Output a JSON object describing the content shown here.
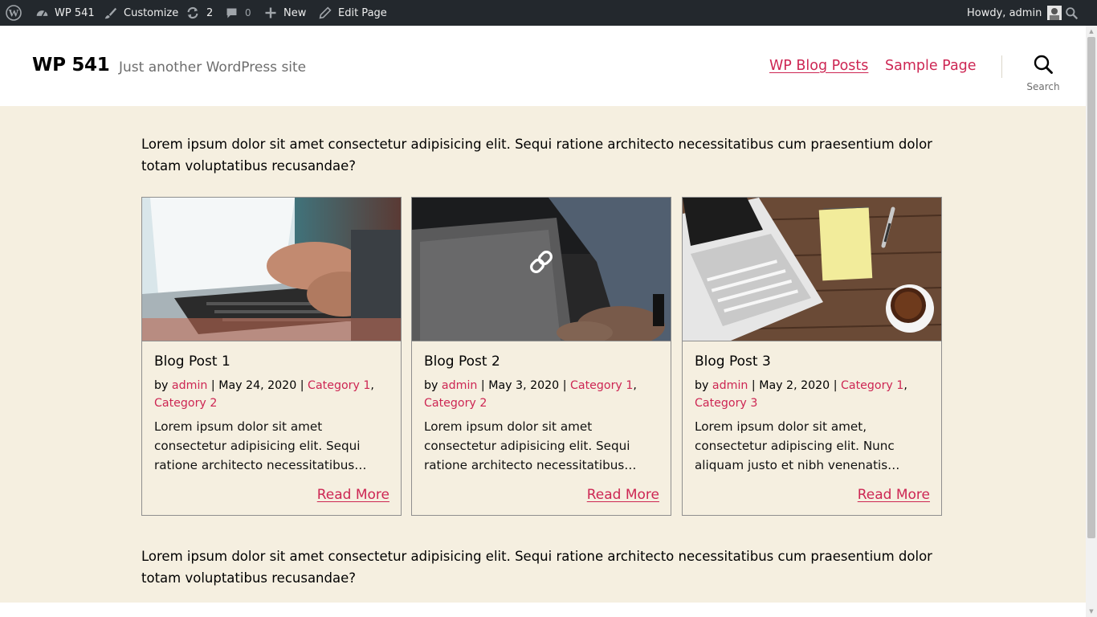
{
  "admin_bar": {
    "site_name": "WP 541",
    "customize_label": "Customize",
    "updates_count": "2",
    "comments_count": "0",
    "new_label": "New",
    "edit_page_label": "Edit Page",
    "greeting": "Howdy, admin"
  },
  "header": {
    "site_title": "WP 541",
    "site_description": "Just another WordPress site",
    "nav": [
      "WP Blog Posts",
      "Sample Page"
    ],
    "search_label": "Search"
  },
  "main": {
    "intro_top": "Lorem ipsum dolor sit amet consectetur adipisicing elit. Sequi ratione architecto necessitatibus cum praesentium dolor totam voluptatibus recusandae?",
    "intro_bottom": "Lorem ipsum dolor sit amet consectetur adipisicing elit. Sequi ratione architecto necessitatibus cum praesentium dolor totam voluptatibus recusandae?",
    "posts": [
      {
        "title": "Blog Post 1",
        "by": "by",
        "author": "admin",
        "date": "May 24, 2020",
        "categories": [
          "Category 1",
          "Category 2"
        ],
        "excerpt": "Lorem ipsum dolor sit amet consectetur adipisicing elit. Sequi ratione architecto necessitatibus…",
        "read_more": "Read More"
      },
      {
        "title": "Blog Post 2",
        "by": "by",
        "author": "admin",
        "date": "May 3, 2020",
        "categories": [
          "Category 1",
          "Category 2"
        ],
        "excerpt": "Lorem ipsum dolor sit amet consectetur adipisicing elit. Sequi ratione architecto necessitatibus…",
        "read_more": "Read More"
      },
      {
        "title": "Blog Post 3",
        "by": "by",
        "author": "admin",
        "date": "May 2, 2020",
        "categories": [
          "Category 1",
          "Category 3"
        ],
        "excerpt": "Lorem ipsum dolor sit amet, consectetur adipiscing elit. Nunc aliquam justo et nibh venenatis…",
        "read_more": "Read More"
      }
    ]
  },
  "colors": {
    "accent": "#cd2653",
    "admin_bar": "#23282d",
    "content_bg": "#f5efe0"
  }
}
